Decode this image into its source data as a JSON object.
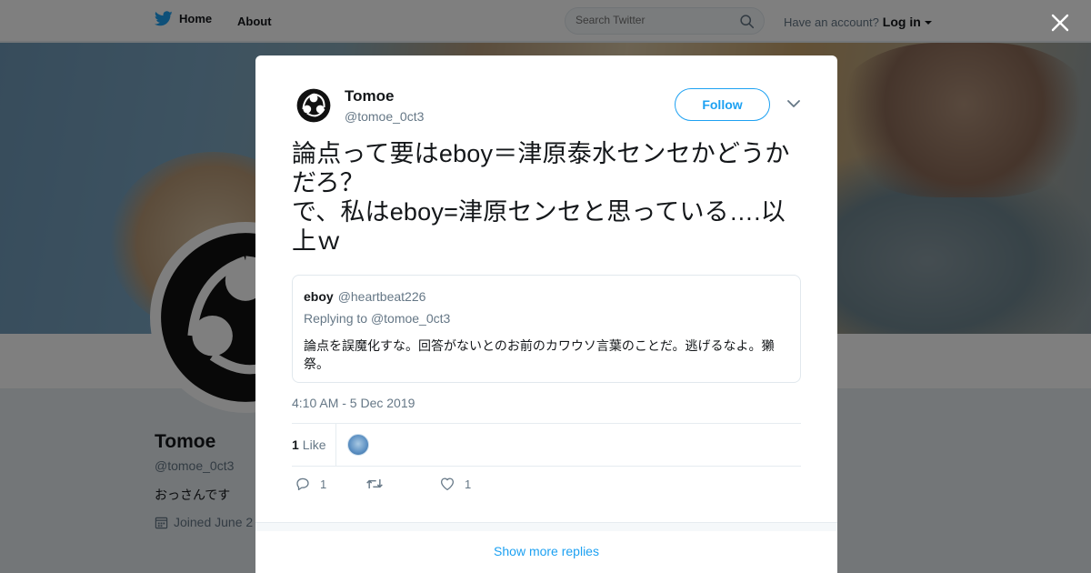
{
  "nav": {
    "home_label": "Home",
    "about_label": "About",
    "search_placeholder": "Search Twitter",
    "account_prompt": "Have an account?",
    "login_label": "Log in"
  },
  "profile": {
    "name": "Tomoe",
    "handle": "@tomoe_0ct3",
    "bio": "おっさんです",
    "joined": "Joined June 2"
  },
  "tweet": {
    "author_name": "Tomoe",
    "author_handle": "@tomoe_0ct3",
    "follow_label": "Follow",
    "text": "論点って要はeboy＝津原泰水センセかどうかだろ？\nで、私はeboy=津原センセと思っている….以上ｗ",
    "timestamp": "4:10 AM - 5 Dec 2019",
    "likes_count": "1",
    "likes_label": "Like",
    "reply_count": "1",
    "like_count_action": "1"
  },
  "quote": {
    "name": "eboy",
    "handle": "@heartbeat226",
    "replying_prefix": "Replying to",
    "replying_handle": "@tomoe_0ct3",
    "text": "論点を誤魔化すな。回答がないとのお前のカワウソ言葉のことだ。逃げるなよ。獺祭。"
  },
  "footer": {
    "show_more_label": "Show more replies"
  },
  "colors": {
    "accent": "#1da1f2",
    "text": "#14171a",
    "muted": "#657786"
  },
  "icons": [
    "twitter-bird-icon",
    "search-icon",
    "close-icon",
    "chevron-down-icon",
    "reply-icon",
    "retweet-icon",
    "heart-icon",
    "calendar-icon"
  ]
}
